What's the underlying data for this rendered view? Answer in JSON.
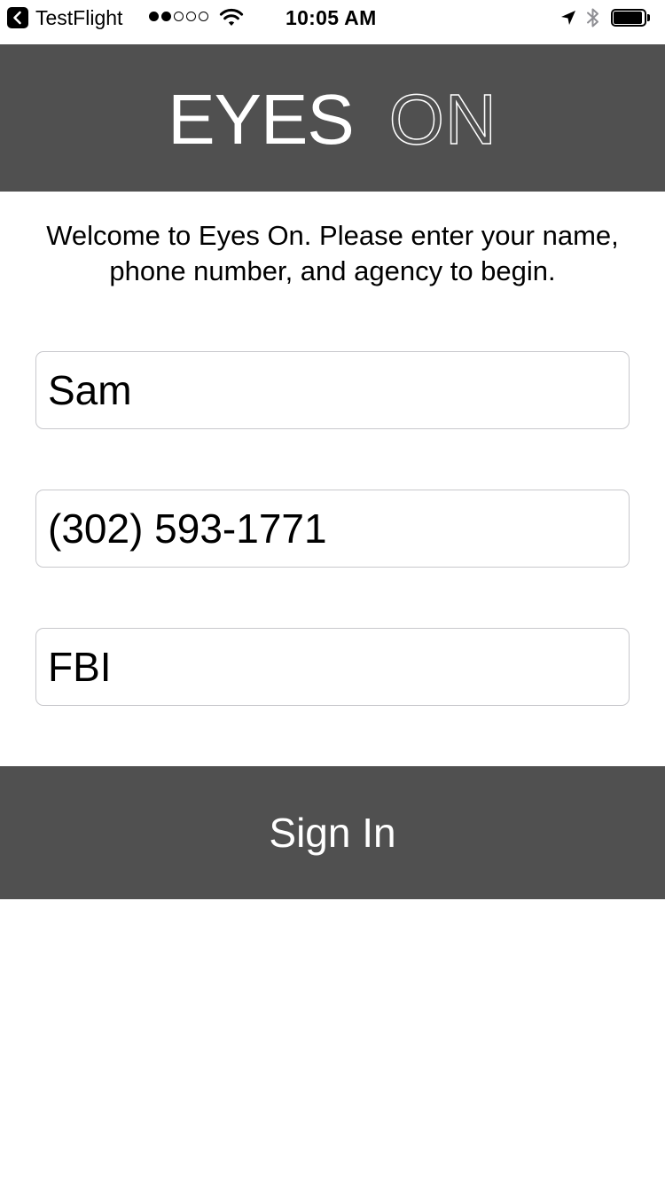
{
  "status_bar": {
    "back_app": "TestFlight",
    "signal_bars_filled": 2,
    "signal_bars_total": 5,
    "time": "10:05 AM",
    "battery_level": 0.95,
    "icons": [
      "back-arrow-icon",
      "wifi-icon",
      "location-arrow-icon",
      "bluetooth-icon",
      "battery-icon"
    ]
  },
  "header": {
    "logo_word1": "EYES",
    "logo_word2": "ON",
    "background_color": "#505050"
  },
  "welcome": {
    "line1": "Welcome to Eyes On. Please enter your name,",
    "line2": "phone number, and agency to begin."
  },
  "form": {
    "name_value": "Sam",
    "phone_value": "(302) 593-1771",
    "agency_value": "FBI"
  },
  "sign_in": {
    "label": "Sign In"
  }
}
